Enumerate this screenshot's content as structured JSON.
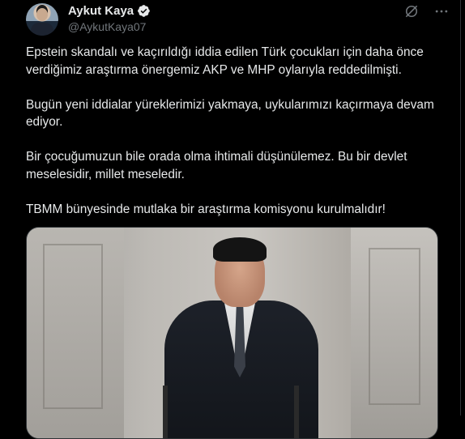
{
  "author": {
    "display_name": "Aykut Kaya",
    "handle": "@AykutKaya07",
    "verified_badge_icon": "verified-badge-icon",
    "badge_color": "#e7e9ea"
  },
  "header_icons": {
    "grok": "grok-icon",
    "more": "more-options-icon"
  },
  "tweet": {
    "paragraphs": [
      "Epstein skandalı ve kaçırıldığı iddia edilen Türk çocukları için daha önce verdiğimiz araştırma önergemiz AKP ve MHP oylarıyla reddedilmişti.",
      "Bugün yeni iddialar yüreklerimizi yakmaya, uykularımızı kaçırmaya devam ediyor.",
      "Bir çocuğumuzun bile orada olma ihtimali düşünülemez. Bu bir devlet meselesidir, millet meseledir.",
      "TBMM bünyesinde mutlaka bir araştırma komisyonu kurulmalıdır!"
    ]
  },
  "media": {
    "type": "video-still"
  },
  "colors": {
    "background": "#000000",
    "text": "#e7e9ea",
    "secondary_text": "#71767b",
    "border": "#2f3336"
  }
}
